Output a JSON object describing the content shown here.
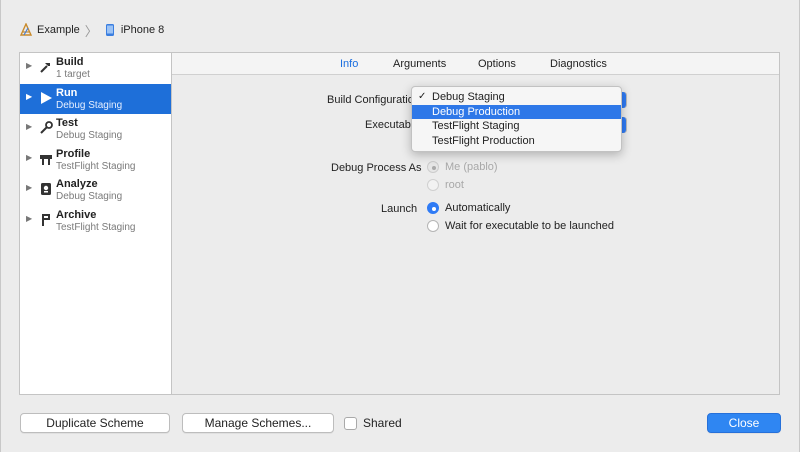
{
  "breadcrumb": {
    "scheme": "Example",
    "destination": "iPhone 8"
  },
  "schemes": [
    {
      "title": "Build",
      "subtitle": "1 target",
      "icon": "hammer-icon",
      "selected": false
    },
    {
      "title": "Run",
      "subtitle": "Debug Staging",
      "icon": "play-icon",
      "selected": true
    },
    {
      "title": "Test",
      "subtitle": "Debug Staging",
      "icon": "wrench-icon",
      "selected": false
    },
    {
      "title": "Profile",
      "subtitle": "TestFlight Staging",
      "icon": "instruments-icon",
      "selected": false
    },
    {
      "title": "Analyze",
      "subtitle": "Debug Staging",
      "icon": "analyze-icon",
      "selected": false
    },
    {
      "title": "Archive",
      "subtitle": "TestFlight Staging",
      "icon": "archive-icon",
      "selected": false
    }
  ],
  "tabs": {
    "info": "Info",
    "arguments": "Arguments",
    "options": "Options",
    "diagnostics": "Diagnostics",
    "active": "Info"
  },
  "form": {
    "build_configuration_label": "Build Configuration",
    "executable_label": "Executable",
    "debug_process_as_label": "Debug Process As",
    "debug_process_options": [
      "Me (pablo)",
      "root"
    ],
    "launch_label": "Launch",
    "launch_options": [
      "Automatically",
      "Wait for executable to be launched"
    ]
  },
  "config_menu": {
    "items": [
      "Debug Staging",
      "Debug Production",
      "TestFlight Staging",
      "TestFlight Production"
    ],
    "checked": "Debug Staging",
    "highlighted": "Debug Production"
  },
  "footer": {
    "duplicate_label": "Duplicate Scheme",
    "manage_label": "Manage Schemes...",
    "shared_label": "Shared",
    "close_label": "Close"
  },
  "colors": {
    "accent": "#2f7bf5",
    "selection": "#1e6fd9"
  }
}
